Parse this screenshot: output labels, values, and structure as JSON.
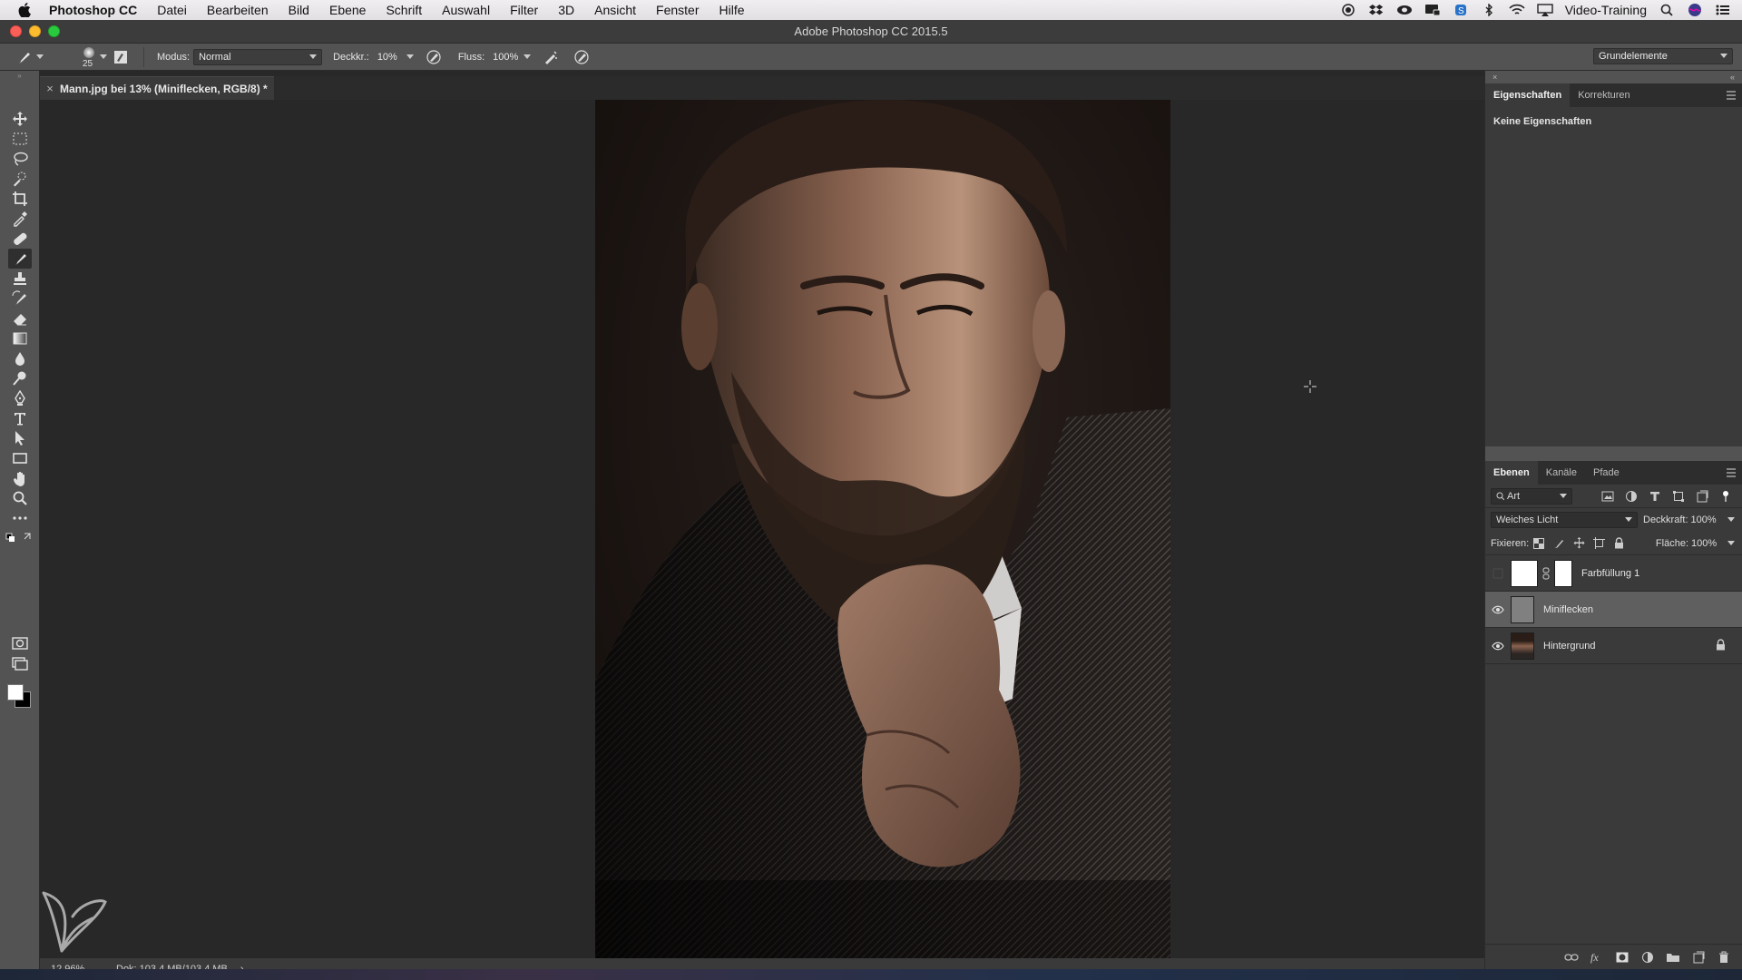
{
  "menubar": {
    "app": "Photoshop CC",
    "items": [
      "Datei",
      "Bearbeiten",
      "Bild",
      "Ebene",
      "Schrift",
      "Auswahl",
      "Filter",
      "3D",
      "Ansicht",
      "Fenster",
      "Hilfe"
    ],
    "user": "Video-Training"
  },
  "window": {
    "title": "Adobe Photoshop CC 2015.5"
  },
  "options": {
    "brush_size": "25",
    "mode_label": "Modus:",
    "mode_value": "Normal",
    "opacity_label": "Deckkr.:",
    "opacity_value": "10%",
    "flow_label": "Fluss:",
    "flow_value": "100%",
    "workspace": "Grundelemente"
  },
  "document": {
    "tab_title": "Mann.jpg bei 13% (Miniflecken, RGB/8) *"
  },
  "status": {
    "zoom": "12,96%",
    "doc_info": "Dok: 103,4 MB/103,4 MB",
    "arrow": "›"
  },
  "properties_panel": {
    "tabs": [
      "Eigenschaften",
      "Korrekturen"
    ],
    "empty_text": "Keine Eigenschaften"
  },
  "layers_panel": {
    "tabs": [
      "Ebenen",
      "Kanäle",
      "Pfade"
    ],
    "filter_value": "Art",
    "blend_mode": "Weiches Licht",
    "opacity_label": "Deckkraft:",
    "opacity_value": "100%",
    "lock_label": "Fixieren:",
    "fill_label": "Fläche:",
    "fill_value": "100%",
    "layers": [
      {
        "name": "Farbfüllung 1",
        "visible": false
      },
      {
        "name": "Miniflecken",
        "visible": true,
        "selected": true
      },
      {
        "name": "Hintergrund",
        "visible": true,
        "locked": true
      }
    ]
  },
  "colors": {
    "ui_panel": "#535353",
    "ui_dark": "#282828",
    "selected_layer": "#5f5f5f",
    "foreground": "#ffffff",
    "background": "#000000"
  }
}
